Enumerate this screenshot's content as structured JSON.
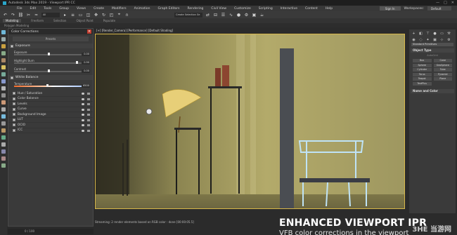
{
  "window": {
    "title": "Autodesk 3ds Max 2019 - Viewport IPR CC",
    "controls": [
      "—",
      "□",
      "✕"
    ]
  },
  "menu": {
    "items": [
      "File",
      "Edit",
      "Tools",
      "Group",
      "Views",
      "Create",
      "Modifiers",
      "Animation",
      "Graph Editors",
      "Rendering",
      "Civil View",
      "Customize",
      "Scripting",
      "Interactive",
      "Content",
      "Help"
    ],
    "sign_in": "Sign In",
    "workspaces_label": "Workspaces:",
    "workspace_value": "Default"
  },
  "toolbar": {
    "filter_select": "All",
    "selection_set": "Create Selection Se"
  },
  "ribbon": {
    "tabs": [
      "Modeling",
      "Freeform",
      "Selection",
      "Object Paint",
      "Populate"
    ],
    "active_tab": "Modeling",
    "sub_label": "Polygon Modeling"
  },
  "color_corrections": {
    "title": "Color Corrections",
    "presets": "Presets",
    "exposure": {
      "label": "Exposure",
      "sliders": [
        {
          "label": "Exposure",
          "value": "0.00"
        },
        {
          "label": "Highlight Burn",
          "value": "0.90"
        },
        {
          "label": "Contrast",
          "value": "0.00"
        }
      ]
    },
    "white_balance": {
      "label": "White Balance",
      "temperature_label": "Temperature",
      "temperature_value": "6500"
    },
    "items": [
      "Hue / Saturation",
      "Color Balance",
      "Levels",
      "Curve",
      "Background Image",
      "LUT",
      "OCIO",
      "ICC"
    ]
  },
  "viewport": {
    "label": "[+] [Render_Camera] [Performance] [Default Shading]",
    "status": "Streaming: 2 render elements based on RGB color : done [00:00:05.5]"
  },
  "frame_counter": "0 / 100",
  "command_panel": {
    "dropdown": "Standard Primitives",
    "object_type_label": "Object Type",
    "autogrid": "AutoGrid",
    "objects": [
      "Box",
      "Cone",
      "Sphere",
      "GeoSphere",
      "Cylinder",
      "Tube",
      "Torus",
      "Pyramid",
      "Teapot",
      "Plane",
      "TextPlus"
    ],
    "name_color_label": "Name and Color"
  },
  "overlay": {
    "headline": "ENHANCED VIEWPORT IPR",
    "subline": "VFB color corrections in the viewport",
    "watermark": "3HE 当游网"
  },
  "colors": {
    "accent": "#2aa6c9",
    "viewport_border": "#d6b64a",
    "close_button": "#c0392b"
  }
}
